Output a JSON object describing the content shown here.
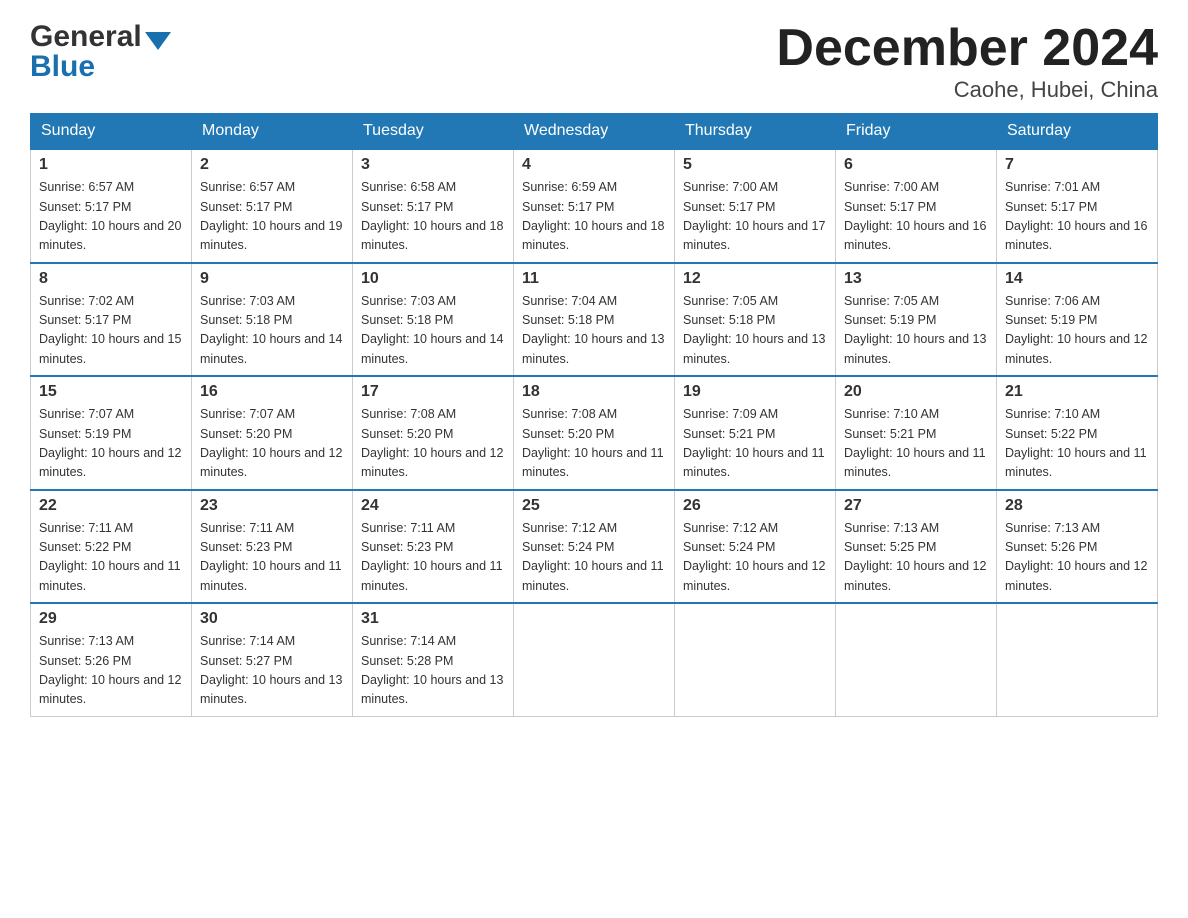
{
  "header": {
    "logo_line1": "General",
    "logo_line2": "Blue",
    "title": "December 2024",
    "subtitle": "Caohe, Hubei, China"
  },
  "days_of_week": [
    "Sunday",
    "Monday",
    "Tuesday",
    "Wednesday",
    "Thursday",
    "Friday",
    "Saturday"
  ],
  "weeks": [
    [
      {
        "num": "1",
        "sunrise": "6:57 AM",
        "sunset": "5:17 PM",
        "daylight": "10 hours and 20 minutes."
      },
      {
        "num": "2",
        "sunrise": "6:57 AM",
        "sunset": "5:17 PM",
        "daylight": "10 hours and 19 minutes."
      },
      {
        "num": "3",
        "sunrise": "6:58 AM",
        "sunset": "5:17 PM",
        "daylight": "10 hours and 18 minutes."
      },
      {
        "num": "4",
        "sunrise": "6:59 AM",
        "sunset": "5:17 PM",
        "daylight": "10 hours and 18 minutes."
      },
      {
        "num": "5",
        "sunrise": "7:00 AM",
        "sunset": "5:17 PM",
        "daylight": "10 hours and 17 minutes."
      },
      {
        "num": "6",
        "sunrise": "7:00 AM",
        "sunset": "5:17 PM",
        "daylight": "10 hours and 16 minutes."
      },
      {
        "num": "7",
        "sunrise": "7:01 AM",
        "sunset": "5:17 PM",
        "daylight": "10 hours and 16 minutes."
      }
    ],
    [
      {
        "num": "8",
        "sunrise": "7:02 AM",
        "sunset": "5:17 PM",
        "daylight": "10 hours and 15 minutes."
      },
      {
        "num": "9",
        "sunrise": "7:03 AM",
        "sunset": "5:18 PM",
        "daylight": "10 hours and 14 minutes."
      },
      {
        "num": "10",
        "sunrise": "7:03 AM",
        "sunset": "5:18 PM",
        "daylight": "10 hours and 14 minutes."
      },
      {
        "num": "11",
        "sunrise": "7:04 AM",
        "sunset": "5:18 PM",
        "daylight": "10 hours and 13 minutes."
      },
      {
        "num": "12",
        "sunrise": "7:05 AM",
        "sunset": "5:18 PM",
        "daylight": "10 hours and 13 minutes."
      },
      {
        "num": "13",
        "sunrise": "7:05 AM",
        "sunset": "5:19 PM",
        "daylight": "10 hours and 13 minutes."
      },
      {
        "num": "14",
        "sunrise": "7:06 AM",
        "sunset": "5:19 PM",
        "daylight": "10 hours and 12 minutes."
      }
    ],
    [
      {
        "num": "15",
        "sunrise": "7:07 AM",
        "sunset": "5:19 PM",
        "daylight": "10 hours and 12 minutes."
      },
      {
        "num": "16",
        "sunrise": "7:07 AM",
        "sunset": "5:20 PM",
        "daylight": "10 hours and 12 minutes."
      },
      {
        "num": "17",
        "sunrise": "7:08 AM",
        "sunset": "5:20 PM",
        "daylight": "10 hours and 12 minutes."
      },
      {
        "num": "18",
        "sunrise": "7:08 AM",
        "sunset": "5:20 PM",
        "daylight": "10 hours and 11 minutes."
      },
      {
        "num": "19",
        "sunrise": "7:09 AM",
        "sunset": "5:21 PM",
        "daylight": "10 hours and 11 minutes."
      },
      {
        "num": "20",
        "sunrise": "7:10 AM",
        "sunset": "5:21 PM",
        "daylight": "10 hours and 11 minutes."
      },
      {
        "num": "21",
        "sunrise": "7:10 AM",
        "sunset": "5:22 PM",
        "daylight": "10 hours and 11 minutes."
      }
    ],
    [
      {
        "num": "22",
        "sunrise": "7:11 AM",
        "sunset": "5:22 PM",
        "daylight": "10 hours and 11 minutes."
      },
      {
        "num": "23",
        "sunrise": "7:11 AM",
        "sunset": "5:23 PM",
        "daylight": "10 hours and 11 minutes."
      },
      {
        "num": "24",
        "sunrise": "7:11 AM",
        "sunset": "5:23 PM",
        "daylight": "10 hours and 11 minutes."
      },
      {
        "num": "25",
        "sunrise": "7:12 AM",
        "sunset": "5:24 PM",
        "daylight": "10 hours and 11 minutes."
      },
      {
        "num": "26",
        "sunrise": "7:12 AM",
        "sunset": "5:24 PM",
        "daylight": "10 hours and 12 minutes."
      },
      {
        "num": "27",
        "sunrise": "7:13 AM",
        "sunset": "5:25 PM",
        "daylight": "10 hours and 12 minutes."
      },
      {
        "num": "28",
        "sunrise": "7:13 AM",
        "sunset": "5:26 PM",
        "daylight": "10 hours and 12 minutes."
      }
    ],
    [
      {
        "num": "29",
        "sunrise": "7:13 AM",
        "sunset": "5:26 PM",
        "daylight": "10 hours and 12 minutes."
      },
      {
        "num": "30",
        "sunrise": "7:14 AM",
        "sunset": "5:27 PM",
        "daylight": "10 hours and 13 minutes."
      },
      {
        "num": "31",
        "sunrise": "7:14 AM",
        "sunset": "5:28 PM",
        "daylight": "10 hours and 13 minutes."
      },
      null,
      null,
      null,
      null
    ]
  ],
  "cell_labels": {
    "sunrise": "Sunrise: ",
    "sunset": "Sunset: ",
    "daylight": "Daylight: "
  }
}
